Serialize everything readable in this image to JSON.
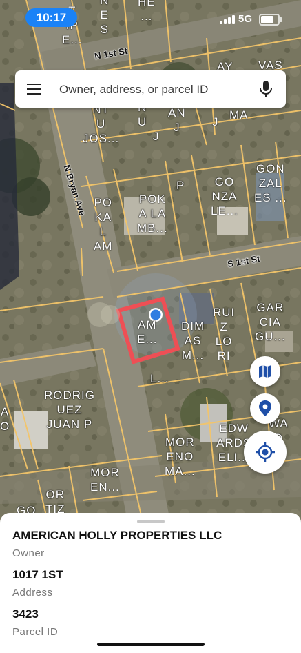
{
  "status_bar": {
    "time": "10:17",
    "network": "5G"
  },
  "search": {
    "placeholder": "Owner, address, or parcel ID"
  },
  "map": {
    "streets": [
      "N 1st St",
      "N Bryan Ave",
      "S 1st St"
    ],
    "parcel_labels": [
      "N\nE\nS",
      "HE\n...",
      "T\nIP\nE...",
      "AY",
      "VAS",
      "C\nA\nNT\nU\nJOS...",
      "N\nU",
      "\nJ",
      "AN\nJ",
      "J",
      "MA",
      "P",
      "GO\nNZA\nLE...",
      "GON\nZAL\nES ...",
      "PO\nKA\nL\nAM",
      "POK\nA LA\nMB...",
      "AM\nE...",
      "DIM\nAS\nM...",
      "RUI\nZ\nLO\nRI",
      "GAR\nCIA\nGU...",
      "L...",
      "A\nO",
      "RODRIG\nUEZ\nJUAN P",
      "MOR\nENO\nMA...",
      "EDW\nARDS\nELI...",
      "WA\nD\nE",
      "MOR\nEN...",
      "OR\nTIZ",
      "GO"
    ],
    "colors": {
      "parcel_line": "#f3c56a",
      "selected_parcel": "#ee4f55",
      "location_dot": "#2f7de1"
    }
  },
  "controls": {
    "icons": [
      "map-layers-icon",
      "pin-icon",
      "my-location-icon"
    ]
  },
  "details": {
    "owner_value": "AMERICAN HOLLY PROPERTIES LLC",
    "owner_label": "Owner",
    "address_value": "1017 1ST",
    "address_label": "Address",
    "parcel_value": "3423",
    "parcel_label": "Parcel ID"
  }
}
